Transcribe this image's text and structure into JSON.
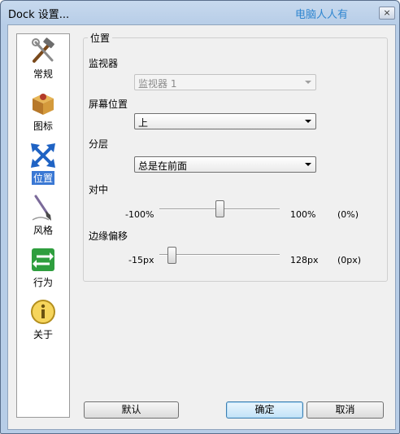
{
  "window": {
    "title": "Dock 设置...",
    "watermark": "电脑人人有",
    "close": "×"
  },
  "sidebar": {
    "items": [
      {
        "label": "常规",
        "icon": "tools-icon"
      },
      {
        "label": "图标",
        "icon": "box-icon"
      },
      {
        "label": "位置",
        "icon": "move-arrows-icon",
        "active": true
      },
      {
        "label": "风格",
        "icon": "brush-icon"
      },
      {
        "label": "行为",
        "icon": "swap-arrows-icon"
      },
      {
        "label": "关于",
        "icon": "info-icon"
      }
    ]
  },
  "panel": {
    "title": "位置",
    "monitor": {
      "label": "监视器",
      "value": "监视器 1"
    },
    "screen_position": {
      "label": "屏幕位置",
      "value": "上"
    },
    "layer": {
      "label": "分层",
      "value": "总是在前面"
    },
    "centering": {
      "label": "对中",
      "min": "-100%",
      "max": "100%",
      "value": "(0%)",
      "fraction": 0.5
    },
    "edge_offset": {
      "label": "边缘偏移",
      "min": "-15px",
      "max": "128px",
      "value": "(0px)",
      "fraction": 0.105
    }
  },
  "buttons": {
    "default": "默认",
    "ok": "确定",
    "cancel": "取消"
  },
  "colors": {
    "accent": "#3a78d4",
    "watermark": "#2f86d0"
  }
}
